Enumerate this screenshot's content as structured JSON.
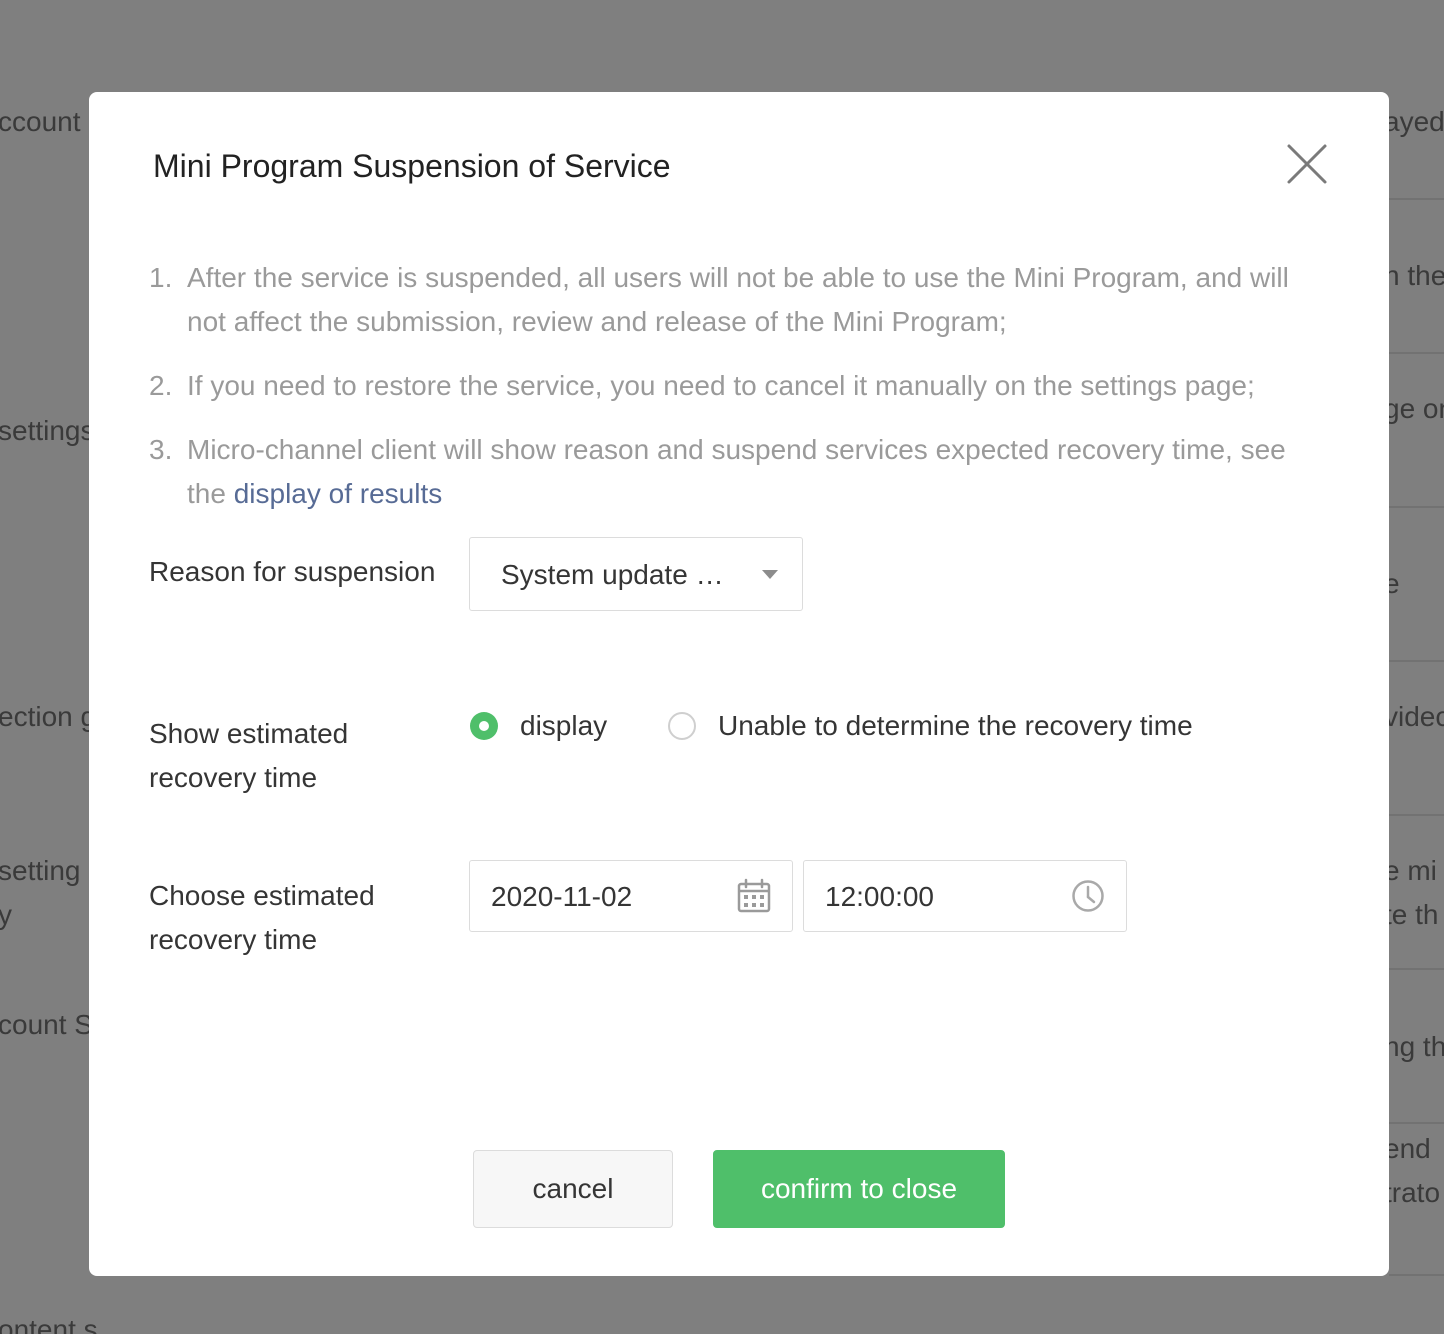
{
  "background": {
    "left_fragments": [
      "ccount",
      "settings",
      "ection g",
      "setting",
      "y",
      "count S",
      "ontent s"
    ],
    "right_fragments": [
      "ayed",
      "n the",
      "ge on",
      "e",
      "videc",
      "e mi",
      "te th",
      "ng th",
      "end",
      "trato"
    ]
  },
  "modal": {
    "title": "Mini Program Suspension of Service",
    "close_icon": "close-icon",
    "notes": [
      {
        "num": "1.",
        "text": "After the service is suspended, all users will not be able to use the Mini Program, and will not affect the submission, review and release of the Mini Program;"
      },
      {
        "num": "2.",
        "text": "If you need to restore the service, you need to cancel it manually on the settings page;"
      },
      {
        "num": "3.",
        "text": "Micro-channel client will show reason and suspend services expected recovery time, see the ",
        "link": "display of results"
      }
    ],
    "form": {
      "reason": {
        "label": "Reason for suspension",
        "value": "System update maintenance"
      },
      "show_time": {
        "label": "Show estimated recovery time",
        "options": [
          {
            "label": "display",
            "checked": true
          },
          {
            "label": "Unable to determine the recovery time",
            "checked": false
          }
        ]
      },
      "choose_time": {
        "label": "Choose estimated recovery time",
        "date": "2020-11-02",
        "time": "12:00:00",
        "date_icon": "calendar-icon",
        "time_icon": "clock-icon"
      }
    },
    "buttons": {
      "cancel": "cancel",
      "confirm": "confirm to close"
    }
  },
  "colors": {
    "accent": "#4fbf6a",
    "link": "#576b95",
    "overlay": "#7f7f7f"
  }
}
